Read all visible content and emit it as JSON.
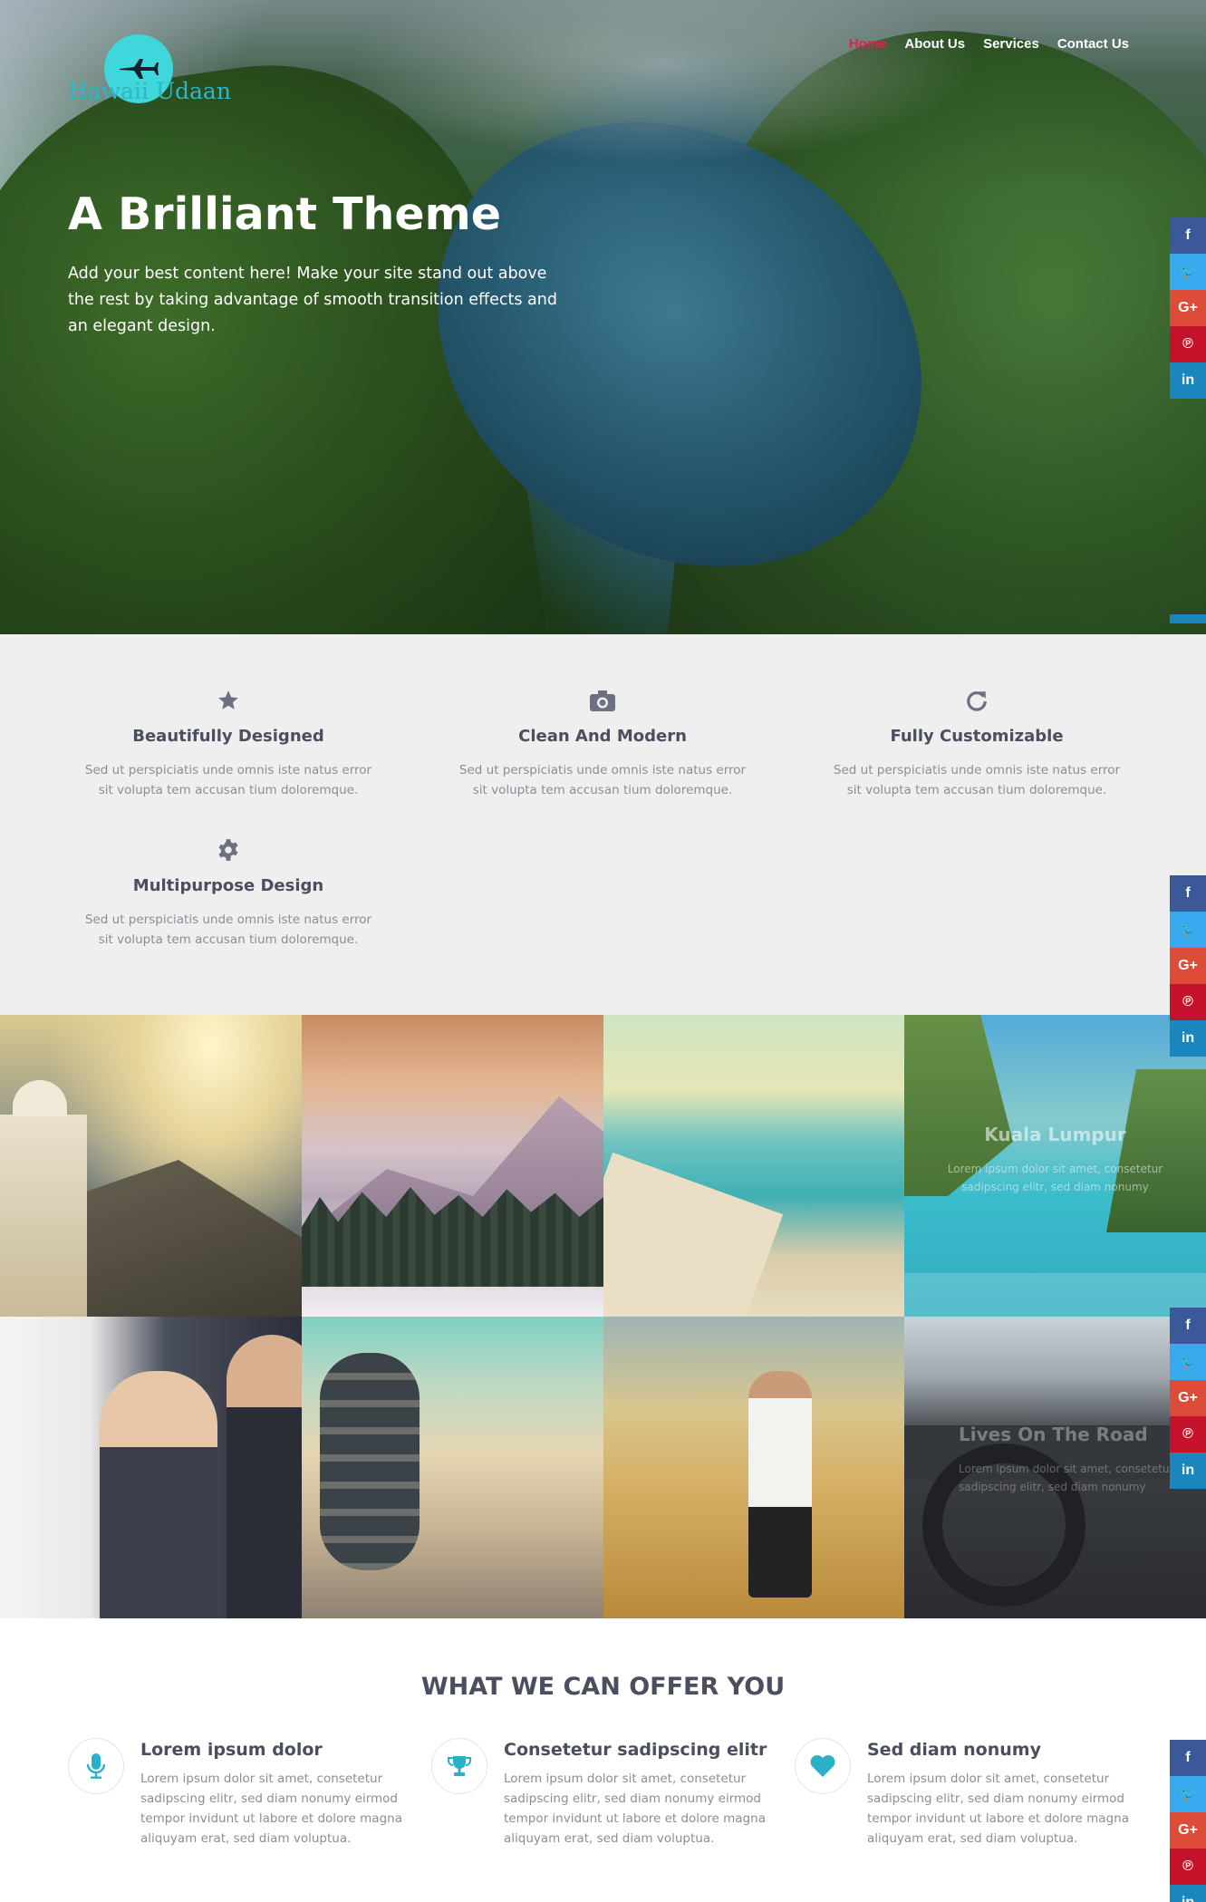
{
  "brand": {
    "name": "Hawaii Udaan",
    "logo_icon": "airplane-icon",
    "accent": "#3fd6dc"
  },
  "nav": {
    "items": [
      {
        "label": "Home",
        "active": true
      },
      {
        "label": "About Us",
        "active": false
      },
      {
        "label": "Services",
        "active": false
      },
      {
        "label": "Contact Us",
        "active": false
      }
    ],
    "active_color": "#e0234a"
  },
  "hero": {
    "title": "A Brilliant Theme",
    "text": "Add your best content here! Make your site stand out above the rest by taking advantage of smooth transition effects and an elegant design."
  },
  "social": {
    "items": [
      {
        "icon": "facebook-icon",
        "label": "f",
        "color": "#3b5998"
      },
      {
        "icon": "twitter-icon",
        "label": "🐦",
        "color": "#38a9ee"
      },
      {
        "icon": "google-plus-icon",
        "label": "G+",
        "color": "#dd4b39"
      },
      {
        "icon": "pinterest-icon",
        "label": "℗",
        "color": "#c4122a"
      },
      {
        "icon": "linkedin-icon",
        "label": "in",
        "color": "#1b86bd"
      }
    ]
  },
  "features": [
    {
      "icon": "star-icon",
      "title": "Beautifully Designed",
      "text": "Sed ut perspiciatis unde omnis iste natus error sit volupta tem accusan tium doloremque."
    },
    {
      "icon": "camera-icon",
      "title": "Clean And Modern",
      "text": "Sed ut perspiciatis unde omnis iste natus error sit volupta tem accusan tium doloremque."
    },
    {
      "icon": "refresh-icon",
      "title": "Fully Customizable",
      "text": "Sed ut perspiciatis unde omnis iste natus error sit volupta tem accusan tium doloremque."
    },
    {
      "icon": "gear-icon",
      "title": "Multipurpose Design",
      "text": "Sed ut perspiciatis unde omnis iste natus error sit volupta tem accusan tium doloremque."
    }
  ],
  "gallery": {
    "hover_tile": {
      "title": "Kuala Lumpur",
      "text": "Lorem ipsum dolor sit amet, consetetur sadipscing elitr, sed diam nonumy"
    },
    "partial_tile": {
      "title": "Lives On The Road",
      "text": "Lorem ipsum dolor sit amet, consetetur sadipscing elitr, sed diam nonumy"
    }
  },
  "offer": {
    "title": "WHAT WE CAN OFFER YOU",
    "items": [
      {
        "icon": "microphone-icon",
        "title": "Lorem ipsum dolor",
        "text": "Lorem ipsum dolor sit amet, consetetur sadipscing elitr, sed diam nonumy eirmod tempor invidunt ut labore et dolore magna aliquyam erat, sed diam voluptua."
      },
      {
        "icon": "trophy-icon",
        "title": "Consetetur sadipscing elitr",
        "text": "Lorem ipsum dolor sit amet, consetetur sadipscing elitr, sed diam nonumy eirmod tempor invidunt ut labore et dolore magna aliquyam erat, sed diam voluptua."
      },
      {
        "icon": "heart-icon",
        "title": "Sed diam nonumy",
        "text": "Lorem ipsum dolor sit amet, consetetur sadipscing elitr, sed diam nonumy eirmod tempor invidunt ut labore et dolore magna aliquyam erat, sed diam voluptua."
      }
    ],
    "icon_color": "#2ab0c9"
  }
}
